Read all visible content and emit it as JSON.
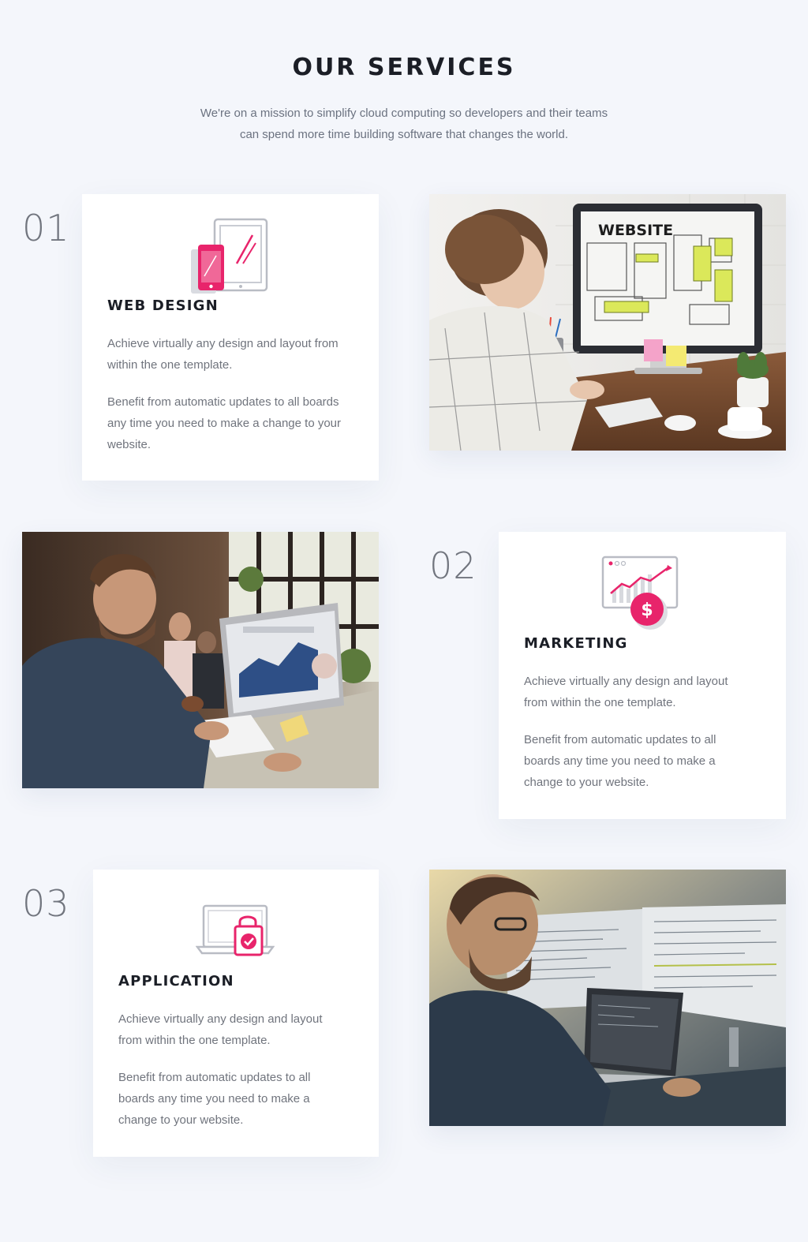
{
  "header": {
    "title": "OUR SERVICES",
    "subtitle_line1": "We're on a mission to simplify cloud computing so developers and their teams",
    "subtitle_line2": "can spend more time building software that changes the world."
  },
  "accent_color": "#e8246b",
  "services": [
    {
      "number": "01",
      "icon": "tablet-phone-design-icon",
      "title": "WEB DESIGN",
      "text1_l1": "Achieve virtually any design and layout from",
      "text1_l2": "within the one template.",
      "text2_l1": "Benefit from automatic updates to all boards",
      "text2_l2": "any time you need to make a change to your",
      "text2_l3": "website.",
      "photo": "woman-at-computer-photo",
      "photo_screen_text": "WEBSITE"
    },
    {
      "number": "02",
      "icon": "chart-dollar-icon",
      "title": "MARKETING",
      "text1_l1": "Achieve virtually any design and layout",
      "text1_l2": "from within the one template.",
      "text2_l1": "Benefit from automatic updates to all",
      "text2_l2": "boards any time you need to make a",
      "text2_l3": "change to your website.",
      "photo": "man-at-computer-photo"
    },
    {
      "number": "03",
      "icon": "laptop-lock-icon",
      "title": "APPLICATION",
      "text1_l1": "Achieve virtually any design and layout",
      "text1_l2": "from within the one template.",
      "text2_l1": "Benefit from automatic updates to all",
      "text2_l2": "boards any time you need to make a",
      "text2_l3": "change to your website.",
      "photo": "developer-coding-photo"
    }
  ]
}
